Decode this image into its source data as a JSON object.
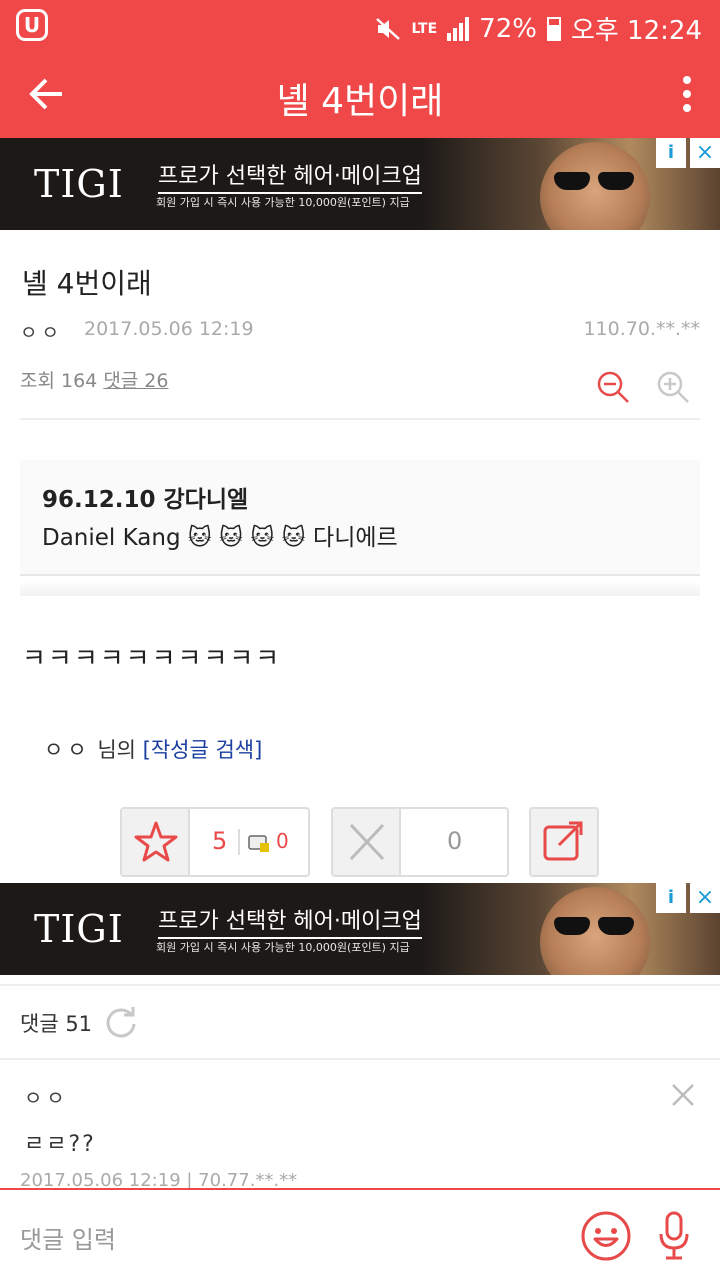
{
  "status_bar": {
    "app_badge": "U+",
    "network": "LTE",
    "battery": "72%",
    "time": "오후 12:24"
  },
  "app_bar": {
    "title": "녤 4번이래",
    "back_icon": "arrow-left-icon",
    "menu_icon": "more-vertical-icon"
  },
  "ads": [
    {
      "logo": "TIGI",
      "headline": "프로가 선택한 헤어·메이크업",
      "subtext": "회원 가입 시 즉시 사용 가능한 10,000원(포인트) 지급",
      "info_label": "i",
      "close_label": "×"
    },
    {
      "logo": "TIGI",
      "headline": "프로가 선택한 헤어·메이크업",
      "subtext": "회원 가입 시 즉시 사용 가능한 10,000원(포인트) 지급",
      "info_label": "i",
      "close_label": "×"
    }
  ],
  "post": {
    "title": "녤 4번이래",
    "author": "ㅇㅇ",
    "date": "2017.05.06 12:19",
    "ip": "110.70.**.**",
    "views_label": "조회 164",
    "comments_label": "댓글 26",
    "embed": {
      "title": "96.12.10 강다니엘",
      "text": "Daniel Kang 🐱 🐱 🐱 🐱 다니에르"
    },
    "body": "ㅋㅋㅋㅋㅋㅋㅋㅋㅋㅋ",
    "author_suffix": "님의",
    "author_search": "[작성글 검색]",
    "recommend_count": "5",
    "fixed_count": "0",
    "not_recommend_count": "0"
  },
  "comments": {
    "header": "댓글 51",
    "items": [
      {
        "author": "ㅇㅇ",
        "text": "ㄹㄹ??",
        "meta": "2017.05.06 12:19 | 70.77.**.**"
      }
    ]
  },
  "input": {
    "placeholder": "댓글 입력"
  },
  "colors": {
    "accent": "#f04848",
    "link": "#1a3fa0"
  }
}
